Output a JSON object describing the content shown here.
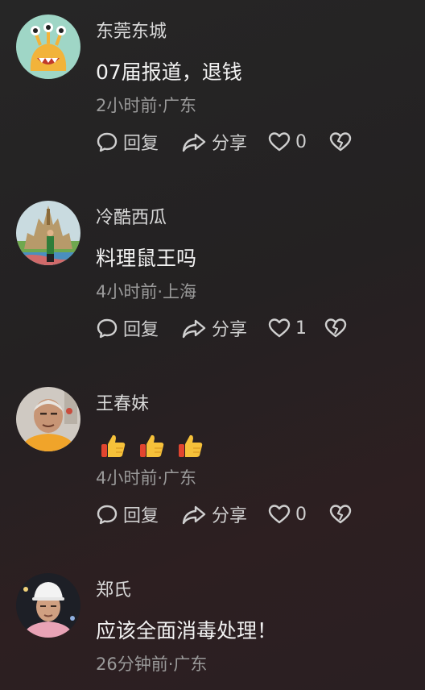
{
  "comments": [
    {
      "name": "东莞东城",
      "text": "07届报道，退钱",
      "meta": "2小时前·广东",
      "like_count": "0",
      "avatar": "yellow-monster-avatar"
    },
    {
      "name": "冷酷西瓜",
      "text": "料理鼠王吗",
      "meta": "4小时前·上海",
      "like_count": "1",
      "avatar": "castle-painting-avatar"
    },
    {
      "name": "王春妹",
      "text": "👍 👍 👍",
      "meta": "4小时前·广东",
      "like_count": "0",
      "avatar": "elderly-man-avatar"
    },
    {
      "name": "郑氏",
      "text": "应该全面消毒处理！",
      "meta": "26分钟前·广东",
      "avatar": "hardhat-man-avatar"
    }
  ],
  "actions": {
    "reply_label": "回复",
    "share_label": "分享"
  }
}
